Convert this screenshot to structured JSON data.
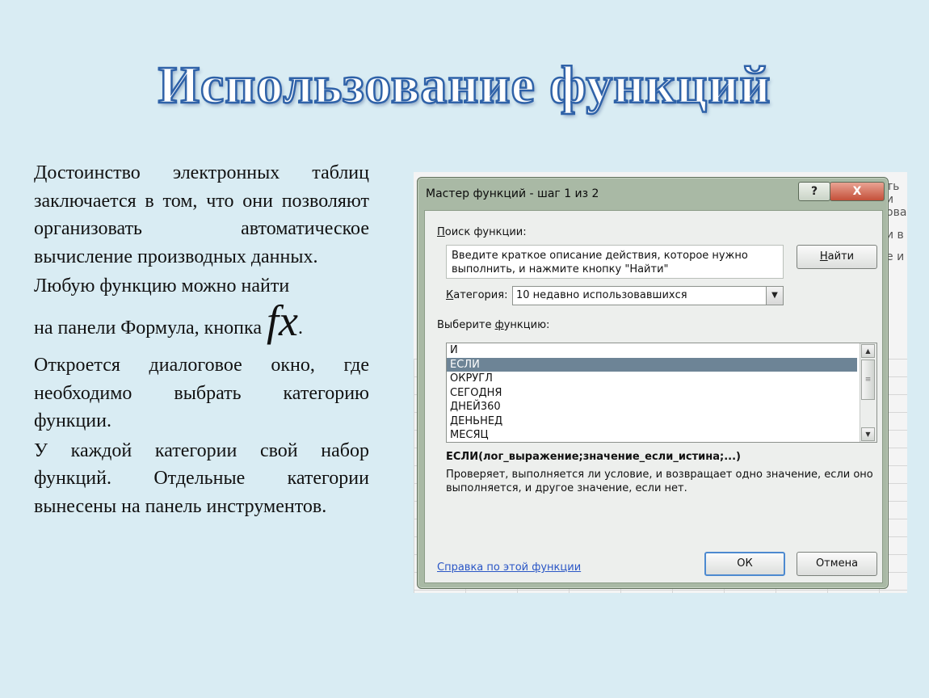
{
  "slide": {
    "title": "Использование функций",
    "paragraphs": [
      "Достоинство электронных таблиц заключается в том, что они позволяют организовать автоматическое вычисление производных данных.",
      "Любую функцию можно найти",
      "на панели Формула, кнопка",
      "Откроется диалоговое окно, где необходимо выбрать категорию функции.",
      "У каждой категории свой набор функций. Отдельные категории вынесены на панель инструментов."
    ],
    "fx_symbol": "fx",
    "fx_tail": "."
  },
  "background_sheet": {
    "cells": [
      "ть и",
      "ова",
      "и в",
      "е и"
    ]
  },
  "dialog": {
    "title": "Мастер функций - шаг 1 из 2",
    "help_button": "?",
    "close_button": "X",
    "search_label_pre": "П",
    "search_label_rest": "оиск функции:",
    "search_text": "Введите краткое описание действия, которое нужно выполнить, и нажмите кнопку \"Найти\"",
    "find_button_hot": "Н",
    "find_button_rest": "айти",
    "category_label_pre": "К",
    "category_label_rest": "атегория:",
    "category_value": "10 недавно использовавшихся",
    "select_label_pre": "Выберите ",
    "select_label_hot": "ф",
    "select_label_rest": "ункцию:",
    "functions": [
      "И",
      "ЕСЛИ",
      "ОКРУГЛ",
      "СЕГОДНЯ",
      "ДНЕЙ360",
      "ДЕНЬНЕД",
      "МЕСЯЦ"
    ],
    "selected_function": "ЕСЛИ",
    "signature": "ЕСЛИ(лог_выражение;значение_если_истина;...)",
    "description": "Проверяет, выполняется ли условие, и возвращает одно значение, если оно выполняется, и другое значение, если нет.",
    "help_link": "Справка по этой функции",
    "ok_button": "ОК",
    "cancel_button": "Отмена"
  }
}
